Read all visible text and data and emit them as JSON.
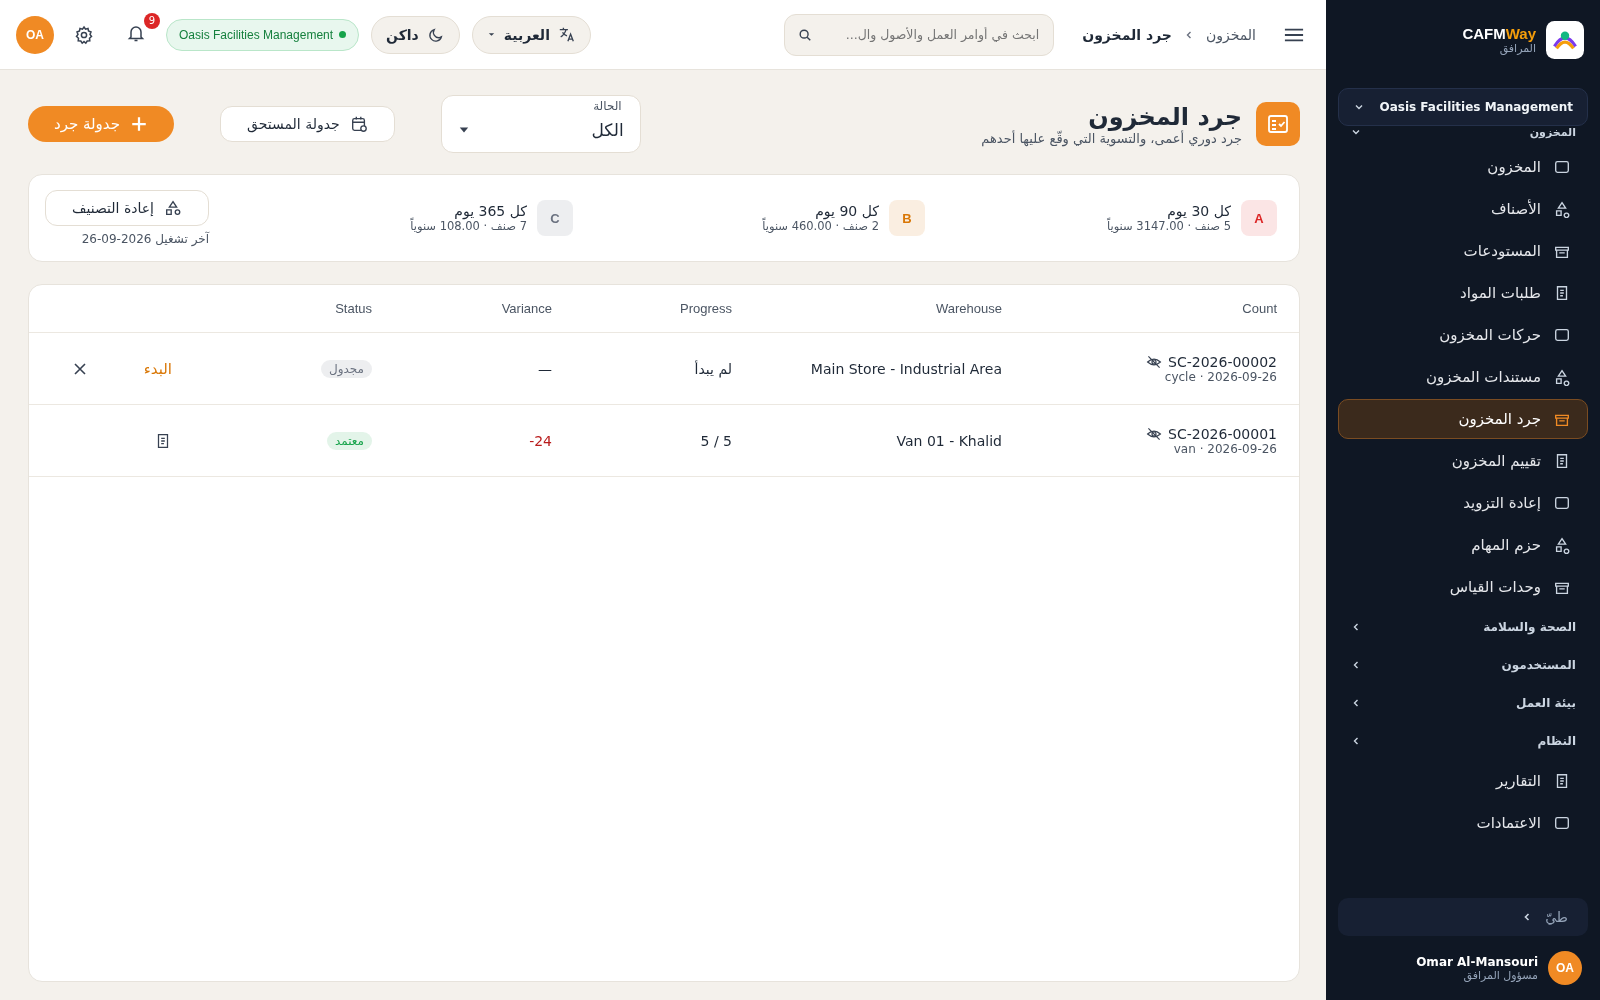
{
  "sidebar": {
    "brand": {
      "name_main": "CAFM",
      "name_accent": "Way",
      "subtitle": "المرافق"
    },
    "org_selector": "Oasis Facilities Management",
    "items": [
      {
        "kind": "group",
        "label": "المخزون",
        "expanded": true
      },
      {
        "kind": "item",
        "label": "المخزون",
        "selected": false
      },
      {
        "kind": "item",
        "label": "الأصناف",
        "selected": false
      },
      {
        "kind": "item",
        "label": "المستودعات",
        "selected": false
      },
      {
        "kind": "item",
        "label": "طلبات المواد",
        "selected": false
      },
      {
        "kind": "item",
        "label": "حركات المخزون",
        "selected": false
      },
      {
        "kind": "item",
        "label": "مستندات المخزون",
        "selected": false
      },
      {
        "kind": "item",
        "label": "جرد المخزون",
        "selected": true
      },
      {
        "kind": "item",
        "label": "تقييم المخزون",
        "selected": false
      },
      {
        "kind": "item",
        "label": "إعادة التزويد",
        "selected": false
      },
      {
        "kind": "item",
        "label": "حزم المهام",
        "selected": false
      },
      {
        "kind": "item",
        "label": "وحدات القياس",
        "selected": false
      },
      {
        "kind": "group",
        "label": "الصحة والسلامة",
        "expanded": false
      },
      {
        "kind": "group",
        "label": "المستخدمون",
        "expanded": false
      },
      {
        "kind": "group",
        "label": "بيئة العمل",
        "expanded": false
      },
      {
        "kind": "group",
        "label": "النظام",
        "expanded": false
      },
      {
        "kind": "item",
        "label": "التقارير",
        "selected": false
      },
      {
        "kind": "item",
        "label": "الاعتمادات",
        "selected": false
      }
    ],
    "collapse": "طيّ",
    "user": {
      "initials": "OA",
      "name": "Omar Al-Mansouri",
      "role": "مسؤول المرافق"
    }
  },
  "topbar": {
    "breadcrumb": [
      "المخزون",
      "جرد المخزون"
    ],
    "search": {
      "placeholder": "ابحث في أوامر العمل والأصول وال..."
    },
    "language": "العربية",
    "theme": "داكن",
    "org": "Oasis Facilities Management",
    "notifications": "9",
    "avatar": "OA"
  },
  "page": {
    "title": "جرد المخزون",
    "subtitle": "جرد دوري أعمى، والتسوية التي وقّع عليها أحدهم",
    "status_filter": {
      "label": "الحالة",
      "value": "الكل"
    },
    "buttons": [
      "جدولة المستحق",
      "جدولة جرد"
    ]
  },
  "classes": [
    {
      "letter": "A",
      "color": "#dc2626",
      "title": "كل 30 يوم",
      "sub": "5 صنف · 3147.00 سنوياً"
    },
    {
      "letter": "B",
      "color": "#d97706",
      "title": "كل 90 يوم",
      "sub": "2 صنف · 460.00 سنوياً"
    },
    {
      "letter": "C",
      "color": "#6b7280",
      "title": "كل 365 يوم",
      "sub": "7 صنف · 108.00 سنوياً"
    }
  ],
  "reclassify": {
    "button": "إعادة التصنيف",
    "last_run": "آخر تشغيل 2026-09-26"
  },
  "table": {
    "columns": [
      "Count",
      "Warehouse",
      "Progress",
      "Variance",
      "Status"
    ],
    "rows": [
      {
        "count": "SC-2026-00002",
        "meta": "cycle · 2026-09-26",
        "warehouse": "Main Store - Industrial Area",
        "progress": "لم يبدأ",
        "variance": "—",
        "variance_negative": false,
        "status": "مجدول",
        "color": "#6b7280",
        "actions": [
          {
            "kind": "link",
            "label": "البدء"
          },
          {
            "kind": "cancel"
          }
        ]
      },
      {
        "count": "SC-2026-00001",
        "meta": "van · 2026-09-26",
        "warehouse": "Van 01 - Khalid",
        "progress": "5 / 5",
        "variance": "-24",
        "variance_negative": true,
        "status": "معتمد",
        "color": "#16a34a",
        "actions": [
          {
            "kind": "document"
          }
        ]
      }
    ]
  }
}
